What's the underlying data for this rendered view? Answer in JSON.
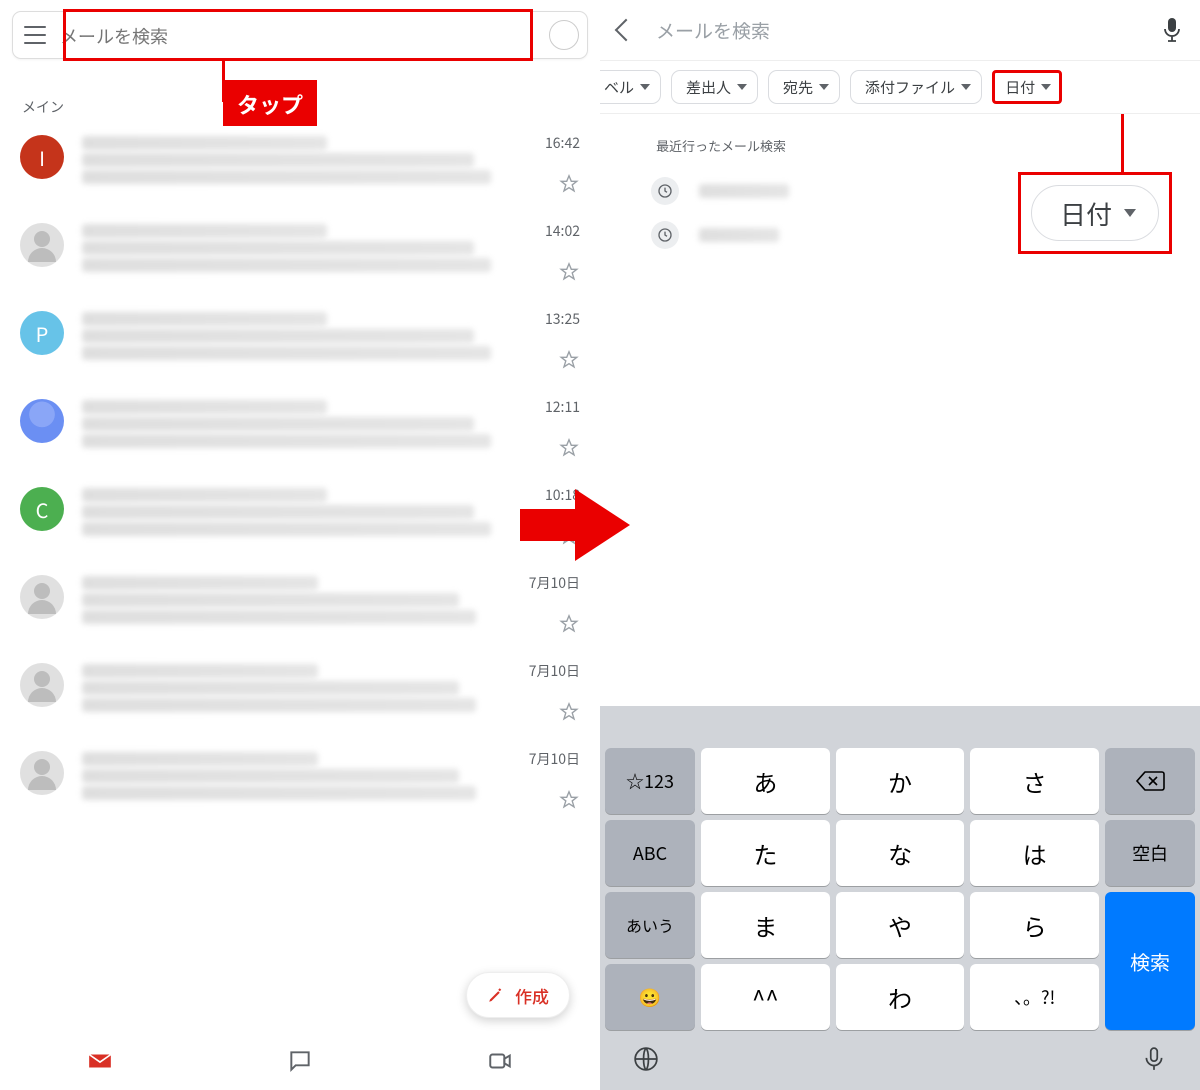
{
  "left": {
    "search_placeholder": "メールを検索",
    "category_label": "メイン",
    "tap_label": "タップ",
    "compose_label": "作成",
    "items": [
      {
        "avatar_letter": "I",
        "avatar_color": "#c5341b",
        "time": "16:42"
      },
      {
        "avatar_letter": "",
        "avatar_color": "gray",
        "time": "14:02"
      },
      {
        "avatar_letter": "P",
        "avatar_color": "#67c3e8",
        "time": "13:25"
      },
      {
        "avatar_letter": "",
        "avatar_color": "#6b8ff3",
        "time": "12:11"
      },
      {
        "avatar_letter": "C",
        "avatar_color": "#4caf50",
        "time": "10:18"
      },
      {
        "avatar_letter": "",
        "avatar_color": "gray",
        "time": "7月10日"
      },
      {
        "avatar_letter": "",
        "avatar_color": "gray",
        "time": "7月10日"
      },
      {
        "avatar_letter": "",
        "avatar_color": "gray",
        "time": "7月10日"
      }
    ]
  },
  "right": {
    "search_placeholder": "メールを検索",
    "chips": [
      "ベル",
      "差出人",
      "宛先",
      "添付ファイル",
      "日付"
    ],
    "recent_label": "最近行ったメール検索",
    "zoom_chip_label": "日付",
    "keyboard": {
      "rows": [
        [
          "☆123",
          "あ",
          "か",
          "さ",
          "⌫"
        ],
        [
          "ABC",
          "た",
          "な",
          "は",
          "空白"
        ],
        [
          "あいう",
          "ま",
          "や",
          "ら",
          "検索"
        ],
        [
          "😀",
          "^^",
          "わ",
          "、。?!",
          ""
        ]
      ]
    }
  }
}
